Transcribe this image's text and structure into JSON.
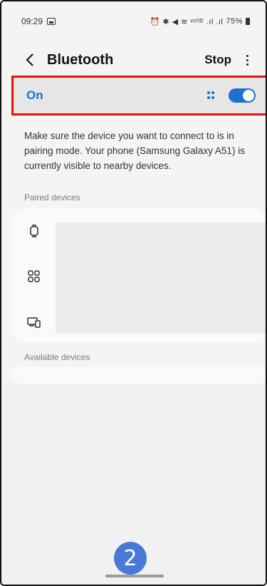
{
  "status_bar": {
    "time": "09:29",
    "right_indicators": "⏰ ✱ ◀ ≋ ᵛᵒˡᵗᴱ .ıl .ıl",
    "battery": "75%"
  },
  "app_bar": {
    "title": "Bluetooth",
    "stop_label": "Stop"
  },
  "bluetooth_toggle": {
    "label": "On",
    "enabled": true,
    "accent_color": "#1f6fd1"
  },
  "description": "Make sure the device you want to connect to is in pairing mode. Your phone (Samsung Galaxy A51) is currently visible to nearby devices.",
  "sections": {
    "paired_label": "Paired devices",
    "available_label": "Available devices"
  },
  "paired_device_icons": [
    "watch-icon",
    "apps-grid-icon",
    "devices-icon"
  ],
  "step_badge": "2"
}
